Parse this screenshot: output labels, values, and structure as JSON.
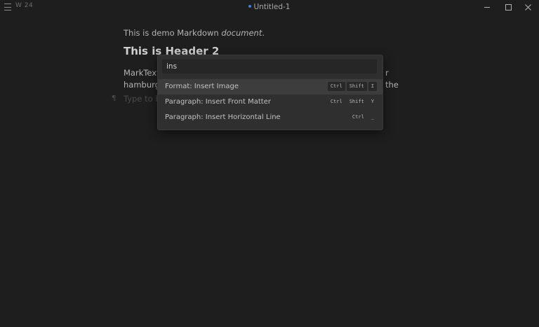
{
  "titlebar": {
    "word_count": "W 24",
    "title": "Untitled-1",
    "unsaved_dot_color": "#3d82d6"
  },
  "editor": {
    "para1_prefix": "This is demo Markdown ",
    "para1_emphasis": "document",
    "para1_suffix": ".",
    "header2": "This is Header 2",
    "para2_start": "MarkText c",
    "para2_end": "r the",
    "para2_line2": "hamburge",
    "placeholder": "Type to be"
  },
  "command_palette": {
    "query": "ins",
    "items": [
      {
        "label": "Format: Insert Image",
        "keys": [
          "Ctrl",
          "Shift",
          "I"
        ]
      },
      {
        "label": "Paragraph: Insert Front Matter",
        "keys": [
          "Ctrl",
          "Shift",
          "Y"
        ]
      },
      {
        "label": "Paragraph: Insert Horizontal Line",
        "keys": [
          "Ctrl",
          "_"
        ]
      }
    ]
  },
  "icons": {
    "menu": "hamburger-icon",
    "minimize": "minimize-icon",
    "maximize": "maximize-icon",
    "close": "close-icon",
    "paragraph": "pilcrow-icon"
  }
}
